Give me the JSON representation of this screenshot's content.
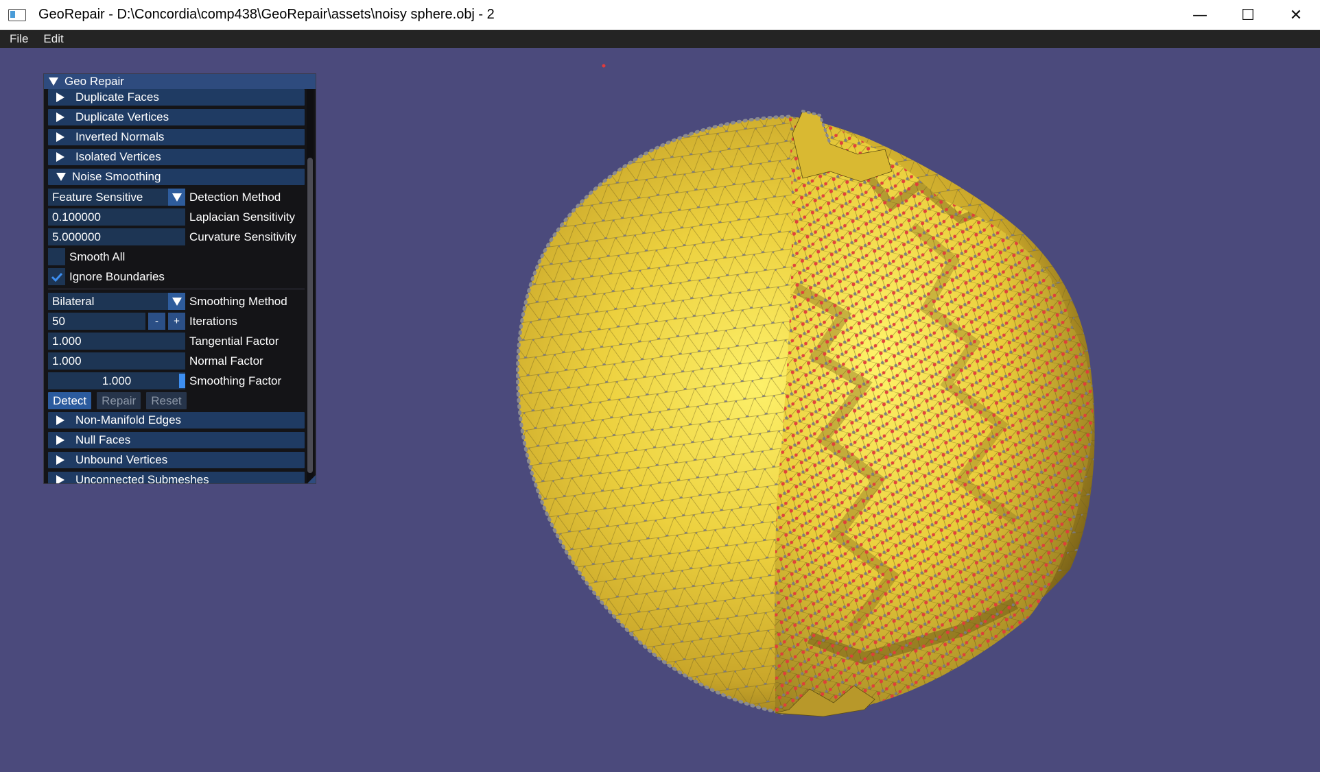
{
  "window": {
    "title": "GeoRepair - D:\\Concordia\\comp438\\GeoRepair\\assets\\noisy sphere.obj - 2",
    "controls": {
      "minimize": "—",
      "maximize": "☐",
      "close": "✕"
    }
  },
  "menu": {
    "file": "File",
    "edit": "Edit"
  },
  "panel": {
    "title": "Geo Repair",
    "sections": {
      "duplicate_faces": "Duplicate Faces",
      "duplicate_vertices": "Duplicate Vertices",
      "inverted_normals": "Inverted Normals",
      "isolated_vertices": "Isolated Vertices",
      "noise_smoothing": "Noise Smoothing",
      "non_manifold_edges": "Non-Manifold Edges",
      "null_faces": "Null Faces",
      "unbound_vertices": "Unbound Vertices",
      "unconnected_submeshes": "Unconnected Submeshes"
    },
    "noise": {
      "detection_method_value": "Feature Sensitive",
      "detection_method_label": "Detection Method",
      "laplacian_value": "0.100000",
      "laplacian_label": "Laplacian Sensitivity",
      "curvature_value": "5.000000",
      "curvature_label": "Curvature Sensitivity",
      "smooth_all_label": "Smooth All",
      "smooth_all_checked": false,
      "ignore_boundaries_label": "Ignore Boundaries",
      "ignore_boundaries_checked": true,
      "smoothing_method_value": "Bilateral",
      "smoothing_method_label": "Smoothing Method",
      "iterations_value": "50",
      "iterations_label": "Iterations",
      "minus": "-",
      "plus": "+",
      "tangential_value": "1.000",
      "tangential_label": "Tangential Factor",
      "normal_value": "1.000",
      "normal_label": "Normal Factor",
      "smoothing_factor_value": "1.000",
      "smoothing_factor_label": "Smoothing Factor",
      "detect": "Detect",
      "repair": "Repair",
      "reset": "Reset"
    }
  },
  "colors": {
    "viewport_bg": "#4b4a7c",
    "mesh_yellow": "#e8c83a",
    "highlight_vertex": "#e23b3b",
    "normal_vertex": "#7a7a82",
    "panel_header": "#1f3b63",
    "panel_title": "#2e4b7e",
    "accent": "#3d8ef0"
  }
}
